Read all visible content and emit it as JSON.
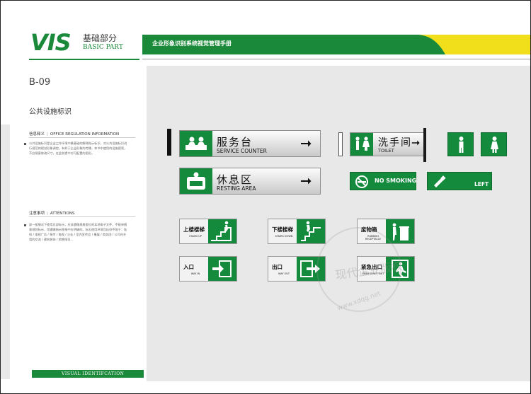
{
  "header": {
    "logo_vis": "VIS",
    "logo_cn": "基础部分",
    "logo_en": "BASIC PART",
    "title": "企业形象识别系统视觉管理手册"
  },
  "left": {
    "code": "B-09",
    "section_title": "公共设施标识",
    "notes": [
      {
        "head_cn": "信息释义",
        "head_en": "OFFICE REGULATION INFORMATION",
        "text": "公共设施标识是企业工作环境中最基础的解释指示标识，对公共设施标识进行规范的视觉形象调控，有利于企业形象的传播，本书中使用的设施图案，不应随意修改尺寸，在此前提中对可配置的图形。"
      },
      {
        "head_cn": "注意事项",
        "head_en": "ATTENTIONS",
        "text": "部一般情况下使用总部标示，应该遵循规格版位的本地电子文件，不能采随意规划标示，常遵循指示图指中应明确的。标志使用环境包括但不限于：贴纸 / 电视广告 / 报传 / 电视 / 企业 / 室内宣传会 / 墨展 / 商务团 / 公司内外墙的交流 / 建筑装饰 / 销售指导..."
      }
    ],
    "footer": "VISUAL IDENTIFCATION"
  },
  "signs": {
    "service_cn": "服务台",
    "service_en": "SERVICE COUNTER",
    "rest_cn": "休息区",
    "rest_en": "RESTING AREA",
    "toilet_cn": "洗手间",
    "toilet_en": "TOILET",
    "no_smoking": "NO SMOKING",
    "left": "LEFT",
    "stairs_up_cn": "上楼楼梯",
    "stairs_up_en": "STAIRS UP",
    "stairs_down_cn": "下楼楼梯",
    "stairs_down_en": "STAIRS DOWN",
    "rubbish_cn": "废物箱",
    "rubbish_en": "RUBBISH RECEPTACLE",
    "way_in_cn": "入口",
    "way_in_en": "WAY IN",
    "way_out_cn": "出口",
    "way_out_en": "WAY OUT",
    "emergency_cn": "紧急出口",
    "emergency_en": "EMERGENCY EXIT"
  },
  "watermark": {
    "cn": "现代企业版权",
    "url": "www.xdqg.net"
  },
  "colors": {
    "brand_green": "#1a8a3a",
    "sign_green": "#138a3c",
    "accent_yellow": "#f2df1c"
  }
}
